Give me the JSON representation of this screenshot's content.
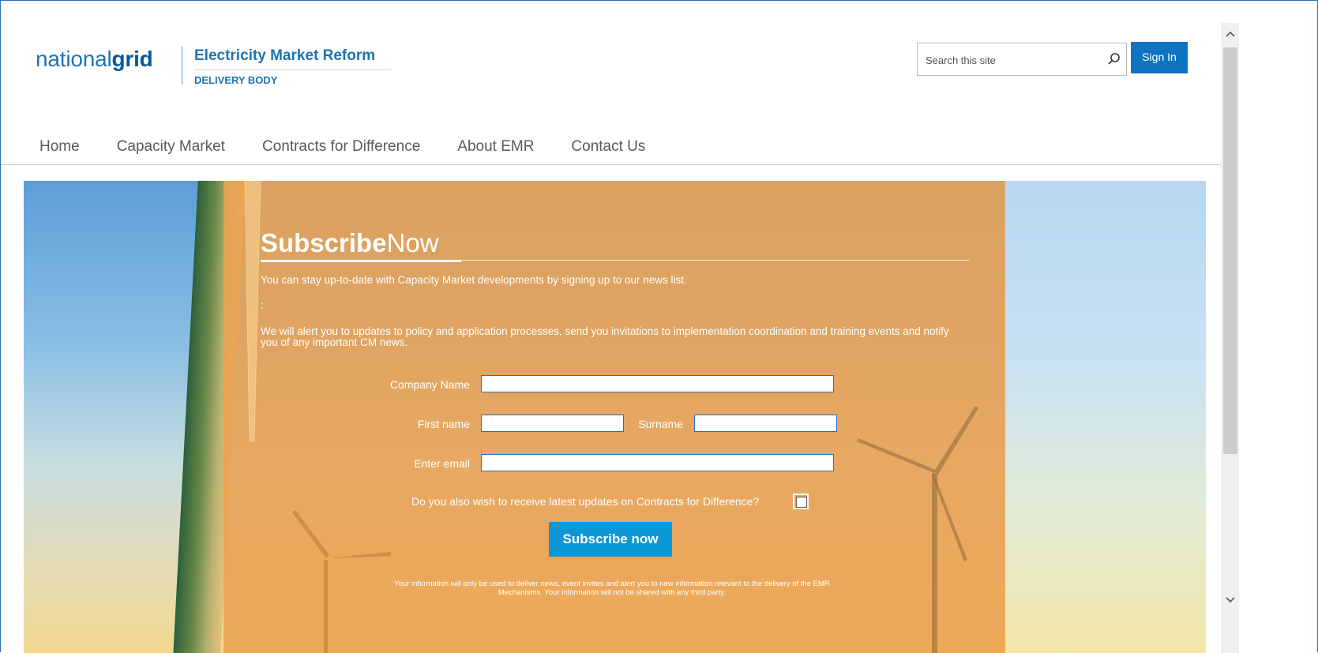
{
  "header": {
    "logo_light": "national",
    "logo_bold": "grid",
    "site_title": "Electricity Market Reform",
    "site_subtitle": "DELIVERY BODY",
    "search_placeholder": "Search this site",
    "signin_label": "Sign In"
  },
  "nav": {
    "items": [
      {
        "label": "Home"
      },
      {
        "label": "Capacity Market"
      },
      {
        "label": "Contracts for Difference"
      },
      {
        "label": "About EMR"
      },
      {
        "label": "Contact Us"
      }
    ]
  },
  "subscribe": {
    "title_bold": "Subscribe",
    "title_light": "Now",
    "intro": "You can stay up-to-date with Capacity Market developments by signing up to our news list.",
    "colon": ":",
    "details": "We will alert you to updates to policy and application processes, send you invitations to implementation coordination and training events and notify you of any important CM news.",
    "company_label": "Company Name",
    "first_name_label": "First name",
    "surname_label": "Surname",
    "email_label": "Enter email",
    "cfd_question": "Do you also wish to receive latest updates on Contracts for Difference?",
    "cfd_checked": false,
    "button_label": "Subscribe now",
    "disclaimer": "Your information will only be used to deliver news, event invites and alert you to new information relevant to the delivery of the EMR Mechanisms. Your information will not be shared with any third party."
  },
  "colors": {
    "brand_blue": "#1d73b4",
    "signin_blue": "#0f73c0",
    "subscribe_blue": "#0e97d7",
    "overlay_orange": "#eca050"
  },
  "scrollbar": {
    "up_icon": "chevron-up-icon",
    "down_icon": "chevron-down-icon"
  }
}
